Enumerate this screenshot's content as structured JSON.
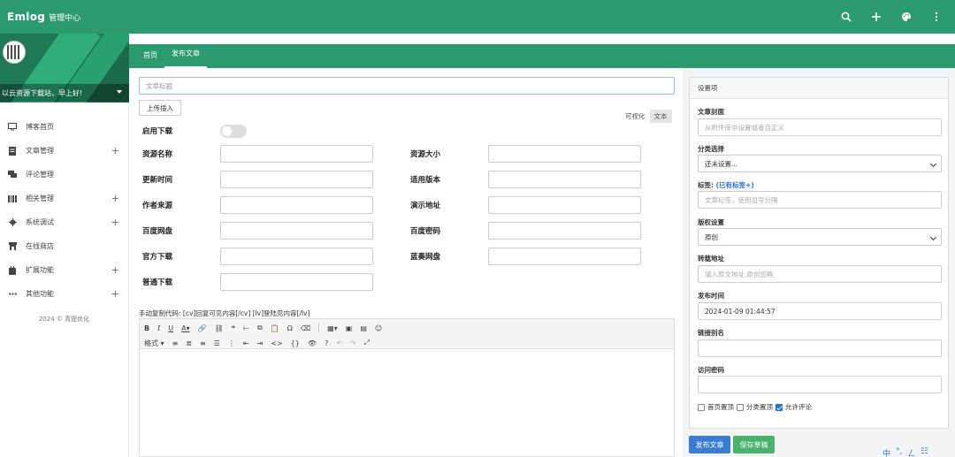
{
  "topbar": {
    "logo": "Emlog",
    "subtitle": "管理中心",
    "icons": [
      "search-icon",
      "plus-icon",
      "palette-icon",
      "more-vertical-icon"
    ]
  },
  "sidebar": {
    "profile_name": "以云资源下载站，早上好!",
    "items": [
      {
        "label": "博客首页",
        "icon": "monitor-icon",
        "expandable": false
      },
      {
        "label": "文章管理",
        "icon": "document-icon",
        "expandable": true
      },
      {
        "label": "评论管理",
        "icon": "comment-icon",
        "expandable": false
      },
      {
        "label": "相关管理",
        "icon": "barcode-icon",
        "expandable": true
      },
      {
        "label": "系统调试",
        "icon": "gear-icon",
        "expandable": true
      },
      {
        "label": "在线商店",
        "icon": "store-icon",
        "expandable": false
      },
      {
        "label": "扩展功能",
        "icon": "plugin-icon",
        "expandable": true
      },
      {
        "label": "其他功能",
        "icon": "ellipsis-icon",
        "expandable": true
      }
    ],
    "footer": "2024 © 青提优化"
  },
  "tabs": [
    {
      "label": "首页",
      "active": false
    },
    {
      "label": "发布文章",
      "active": true
    }
  ],
  "editor": {
    "title_placeholder": "文章标题",
    "upload_button": "上传插入",
    "mode_visual": "可视化",
    "mode_text": "文本",
    "enable_download_label": "启用下载",
    "enable_download": false,
    "fields_left": [
      "资源名称",
      "更新时间",
      "作者来源",
      "百度网盘",
      "官方下载",
      "普通下载"
    ],
    "fields_right": [
      "资源大小",
      "适用版本",
      "演示地址",
      "百度密码",
      "蓝奏网盘"
    ],
    "note": "手动复制代码:  [cv]回复可见内容[/cv]  [lv]登陆见内容[/lv]",
    "format_label": "格式"
  },
  "settings": {
    "header": "设置项",
    "cover_label": "文章封面",
    "cover_placeholder": "从附件库中设置或者自定义",
    "category_label": "分类选择",
    "category_value": "还未设置...",
    "tags_label": "标签:",
    "tags_link": "(已有标签+)",
    "tags_placeholder": "文章标签，使用逗号分隔",
    "copyright_label": "版权设置",
    "copyright_value": "原创",
    "source_label": "转载地址",
    "source_placeholder": "填入原文地址,原创忽略",
    "publish_time_label": "发布时间",
    "publish_time_value": "2024-01-09 01:44:57",
    "alias_label": "链接别名",
    "password_label": "访问密码",
    "check_home_top": "首页置顶",
    "check_cat_top": "分类置顶",
    "check_allow_comment": "允许评论",
    "home_top": false,
    "cat_top": false,
    "allow_comment": true
  },
  "actions": {
    "publish": "发布文章",
    "save_draft": "保存草稿"
  },
  "ime": [
    "中",
    "°,",
    "ㄥ",
    "☷"
  ],
  "colors": {
    "brand_green": "#2b9a6f",
    "publish_blue": "#3a7bd5",
    "draft_green": "#47b36b"
  }
}
